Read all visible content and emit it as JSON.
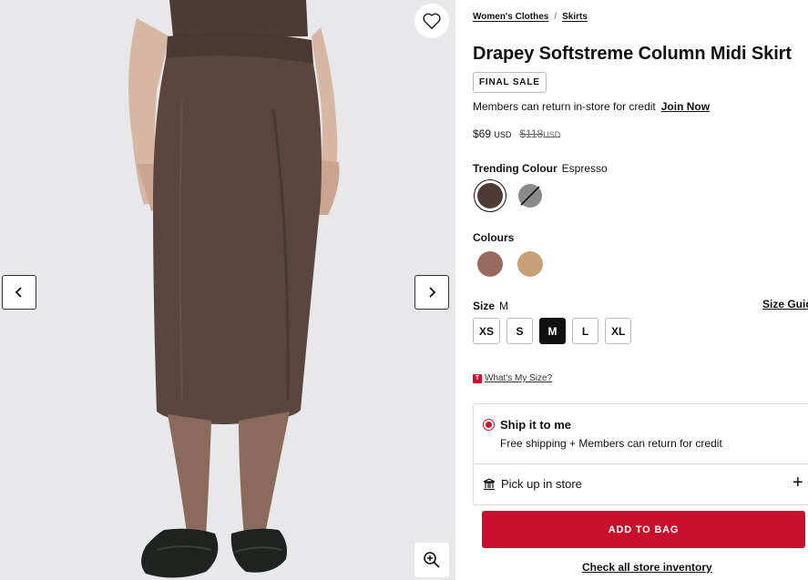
{
  "gallery": {
    "wishlist_icon": "heart-icon",
    "prev_icon": "chevron-left-icon",
    "next_icon": "chevron-right-icon",
    "zoom_icon": "zoom-in-icon"
  },
  "breadcrumb": {
    "items": [
      "Women's Clothes",
      "Skirts"
    ],
    "separator": "/"
  },
  "product": {
    "title": "Drapey Softstreme Column Midi Skirt",
    "badge": "FINAL SALE",
    "members_text": "Members can return in-store for credit",
    "join_link": "Join Now",
    "price": "$69",
    "price_currency": "USD",
    "original_price": "$118",
    "original_currency": "USD"
  },
  "trending_colour": {
    "label": "Trending Colour",
    "value": "Espresso",
    "swatches": [
      {
        "name": "Espresso",
        "color": "#4f3a36",
        "selected": true
      },
      {
        "name": "Unavailable",
        "color": "#8a8a8a",
        "unavailable": true
      }
    ]
  },
  "colours": {
    "label": "Colours",
    "swatches": [
      {
        "color": "#9b6a5e"
      },
      {
        "color": "#c7a175"
      }
    ]
  },
  "size": {
    "label": "Size",
    "value": "M",
    "guide": "Size Guide",
    "options": [
      "XS",
      "S",
      "M",
      "L",
      "XL"
    ],
    "selected": "M"
  },
  "whats_my_size": {
    "logo": "T",
    "link": "What's My Size?"
  },
  "fulfilment": {
    "ship_title": "Ship it to me",
    "ship_sub": "Free shipping + Members can return for credit",
    "pickup": "Pick up in store",
    "plus": "+"
  },
  "actions": {
    "add_to_bag": "ADD TO BAG",
    "store_inventory": "Check all store inventory"
  },
  "colors": {
    "accent": "#c8102e",
    "skirt": "#5a463f"
  }
}
